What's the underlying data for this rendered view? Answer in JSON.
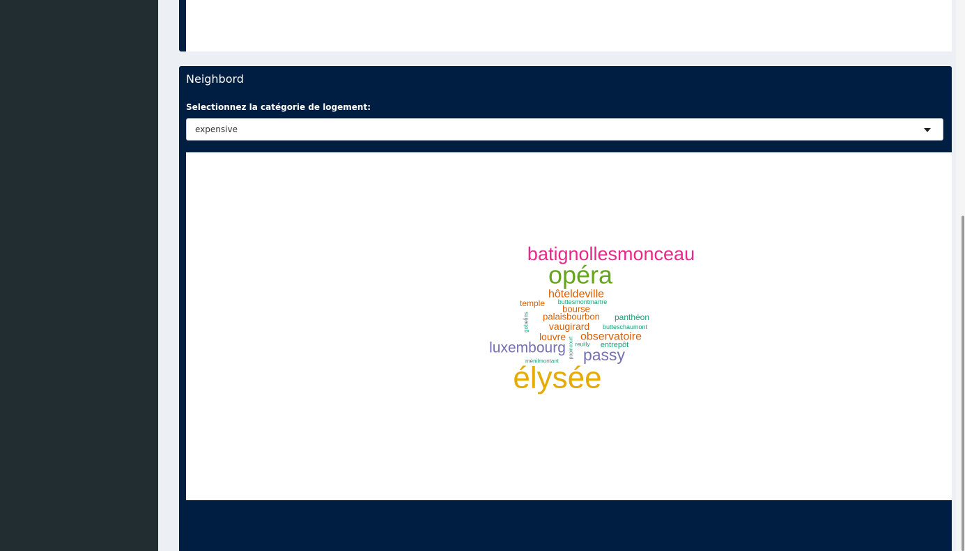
{
  "panel": {
    "title": "Neighbord",
    "select_label": "Selectionnez la catégorie de logement:",
    "selected_value": "expensive"
  },
  "chart_data": {
    "type": "wordcloud",
    "words": [
      {
        "text": "élysée",
        "color": "#E6AB02",
        "size": 44
      },
      {
        "text": "opéra",
        "color": "#66A61E",
        "size": 36
      },
      {
        "text": "batignollesmonceau",
        "color": "#E7298A",
        "size": 27
      },
      {
        "text": "luxembourg",
        "color": "#7570B3",
        "size": 21
      },
      {
        "text": "passy",
        "color": "#7570B3",
        "size": 23
      },
      {
        "text": "hôteldeville",
        "color": "#D95F02",
        "size": 16
      },
      {
        "text": "observatoire",
        "color": "#D95F02",
        "size": 16
      },
      {
        "text": "vaugirard",
        "color": "#D95F02",
        "size": 14
      },
      {
        "text": "louvre",
        "color": "#D95F02",
        "size": 14
      },
      {
        "text": "palaisbourbon",
        "color": "#D95F02",
        "size": 13
      },
      {
        "text": "bourse",
        "color": "#D95F02",
        "size": 13
      },
      {
        "text": "temple",
        "color": "#D95F02",
        "size": 12
      },
      {
        "text": "panthéon",
        "color": "#1B9E77",
        "size": 12
      },
      {
        "text": "entrepôt",
        "color": "#1B9E77",
        "size": 11
      },
      {
        "text": "buttesmontmartre",
        "color": "#1B9E77",
        "size": 9
      },
      {
        "text": "butteschaumont",
        "color": "#1B9E77",
        "size": 9
      },
      {
        "text": "ménilmontant",
        "color": "#1B9E77",
        "size": 8
      },
      {
        "text": "reuilly",
        "color": "#1B9E77",
        "size": 8
      },
      {
        "text": "popincourt",
        "color": "#1B9E77",
        "size": 7
      },
      {
        "text": "gobelins",
        "color": "#1B9E77",
        "size": 8
      }
    ]
  }
}
